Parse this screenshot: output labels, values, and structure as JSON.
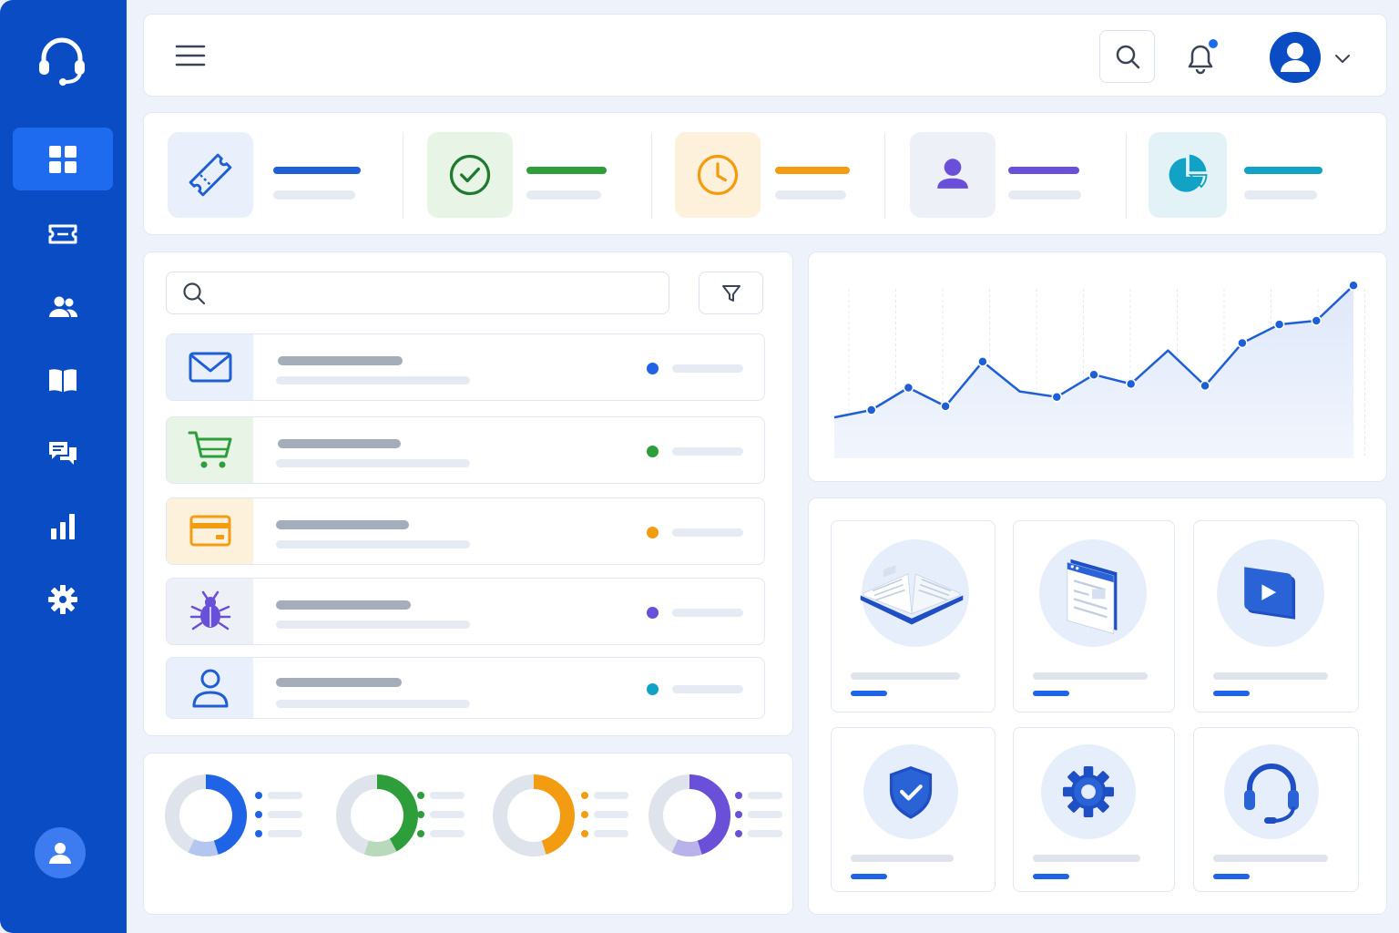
{
  "colors": {
    "sidebar": "#0a4cc4",
    "sidebar_active": "#1e6bf0",
    "primary": "#1f5fd6",
    "green": "#2e9e3a",
    "orange": "#f39c12",
    "purple": "#6a4fd8",
    "teal": "#12a2c6",
    "bell_badge": "#1e6bf0",
    "skeleton": "#e6ebf3"
  },
  "sidebar": {
    "logo_icon": "headset-icon",
    "items": [
      {
        "icon": "dashboard-grid-icon",
        "active": true
      },
      {
        "icon": "ticket-icon",
        "active": false
      },
      {
        "icon": "users-icon",
        "active": false
      },
      {
        "icon": "knowledge-book-icon",
        "active": false
      },
      {
        "icon": "chat-bubbles-icon",
        "active": false
      },
      {
        "icon": "bar-chart-icon",
        "active": false
      },
      {
        "icon": "settings-gear-icon",
        "active": false
      }
    ],
    "footer_icon": "user-avatar-icon"
  },
  "topbar": {
    "menu_icon": "hamburger-menu-icon",
    "search_icon": "search-icon",
    "notification_icon": "bell-icon",
    "notification_badge": true,
    "profile_icon": "user-avatar-icon",
    "profile_chevron": "chevron-down-icon"
  },
  "stats": [
    {
      "icon": "ticket-icon",
      "accent": "#1f5fd6",
      "tint": "#e9f0fc"
    },
    {
      "icon": "check-circle-icon",
      "accent": "#2e9e3a",
      "tint": "#e7f4e6"
    },
    {
      "icon": "clock-icon",
      "accent": "#f39c12",
      "tint": "#fdf1dc"
    },
    {
      "icon": "person-icon",
      "accent": "#6a4fd8",
      "tint": "#eef0f8"
    },
    {
      "icon": "pie-chart-icon",
      "accent": "#12a2c6",
      "tint": "#e3f2f7"
    }
  ],
  "tickets": {
    "search": {
      "value": "",
      "icon": "search-icon"
    },
    "filter_icon": "filter-icon",
    "rows": [
      {
        "icon": "mail-icon",
        "status_color": "#1f63e6",
        "tint": "#e9f0fc"
      },
      {
        "icon": "cart-icon",
        "status_color": "#2e9e3a",
        "tint": "#e7f4e6"
      },
      {
        "icon": "credit-card-icon",
        "status_color": "#f39c12",
        "tint": "#fdf1dc"
      },
      {
        "icon": "bug-icon",
        "status_color": "#6a4fd8",
        "tint": "#eef0f8"
      },
      {
        "icon": "user-outline-icon",
        "status_color": "#12a2c6",
        "tint": "#e9f0fc"
      }
    ]
  },
  "donuts": [
    {
      "color": "#1f63e6",
      "secondary": "#b4c6ef",
      "share": 0.45,
      "secondary_share": 0.12
    },
    {
      "color": "#2e9e3a",
      "secondary": "#b9d9bd",
      "share": 0.42,
      "secondary_share": 0.13
    },
    {
      "color": "#f39c12",
      "secondary": "#e4e8ef",
      "share": 0.45,
      "secondary_share": 0.0
    },
    {
      "color": "#6a4fd8",
      "secondary": "#b9b2ea",
      "share": 0.45,
      "secondary_share": 0.12
    }
  ],
  "chart_data": {
    "type": "area",
    "x": [
      0,
      1,
      2,
      3,
      4,
      5,
      6,
      7,
      8,
      9,
      10,
      11,
      12,
      13,
      14,
      15
    ],
    "series": [
      {
        "values": [
          22,
          26,
          38,
          28,
          52,
          36,
          33,
          45,
          40,
          58,
          39,
          62,
          72,
          74,
          93
        ]
      }
    ],
    "ylim": [
      0,
      100
    ],
    "grid": "vertical dashed",
    "legend": "none"
  },
  "resources": [
    {
      "icon": "open-book-icon"
    },
    {
      "icon": "web-document-icon"
    },
    {
      "icon": "video-play-icon"
    },
    {
      "icon": "shield-check-icon"
    },
    {
      "icon": "gear-icon"
    },
    {
      "icon": "support-headset-icon"
    }
  ]
}
